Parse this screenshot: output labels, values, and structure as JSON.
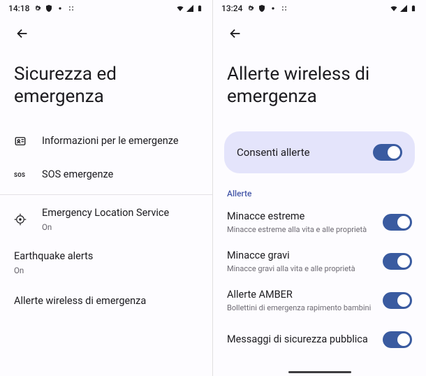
{
  "left": {
    "status_time": "14:18",
    "title": "Sicurezza ed emergenza",
    "items": {
      "info": "Informazioni per le emergenze",
      "sos_icon": "SOS",
      "sos": "SOS emergenze",
      "els_title": "Emergency Location Service",
      "els_sub": "On",
      "eq_title": "Earthquake alerts",
      "eq_sub": "On",
      "wireless": "Allerte wireless di emergenza"
    }
  },
  "right": {
    "status_time": "13:24",
    "title": "Allerte wireless di emergenza",
    "master_label": "Consenti allerte",
    "section": "Allerte",
    "rows": {
      "extreme_t": "Minacce estreme",
      "extreme_s": "Minacce estreme alla vita e alle proprietà",
      "severe_t": "Minacce gravi",
      "severe_s": "Minacce gravi alla vita e alle proprietà",
      "amber_t": "Allerte AMBER",
      "amber_s": "Bollettini di emergenza rapimento bambini",
      "public_t": "Messaggi di sicurezza pubblica"
    }
  }
}
